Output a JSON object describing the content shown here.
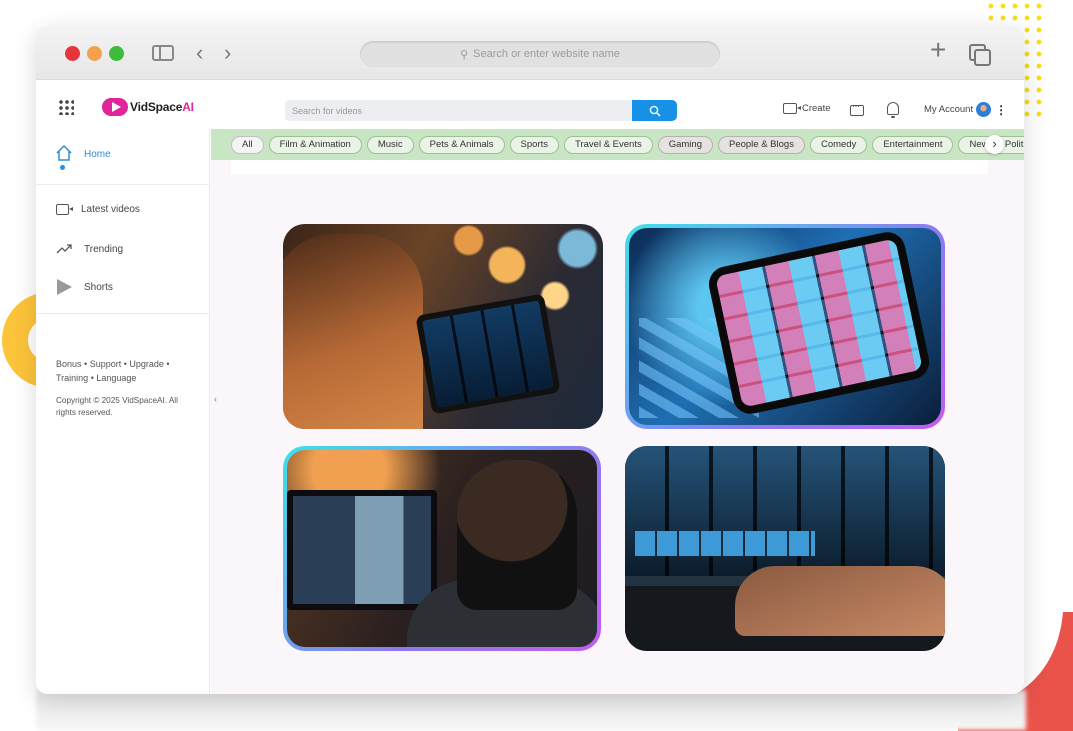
{
  "browser": {
    "url_placeholder": "Search or enter website name"
  },
  "header": {
    "logo_text": "VidSpace",
    "logo_ai": "AI",
    "search_placeholder": "Search for videos",
    "create_label": "Create",
    "account_label": "My Account"
  },
  "sidebar": {
    "items": [
      {
        "label": "Home",
        "icon": "home-icon"
      },
      {
        "label": "Latest videos",
        "icon": "video-icon"
      },
      {
        "label": "Trending",
        "icon": "trending-icon"
      },
      {
        "label": "Shorts",
        "icon": "shorts-icon"
      }
    ],
    "footer_links": [
      "Bonus",
      "Support",
      "Upgrade",
      "Training",
      "Language"
    ],
    "copyright": "Copyright © 2025 VidSpaceAI. All rights reserved."
  },
  "categories": [
    "All",
    "Film & Animation",
    "Music",
    "Pets & Animals",
    "Sports",
    "Travel & Events",
    "Gaming",
    "People & Blogs",
    "Comedy",
    "Entertainment",
    "News & Politics"
  ],
  "colors": {
    "brand_pink": "#e0249a",
    "search_blue": "#1791e6",
    "category_bar": "#c8e6c4",
    "home_active": "#2b8fd6"
  }
}
